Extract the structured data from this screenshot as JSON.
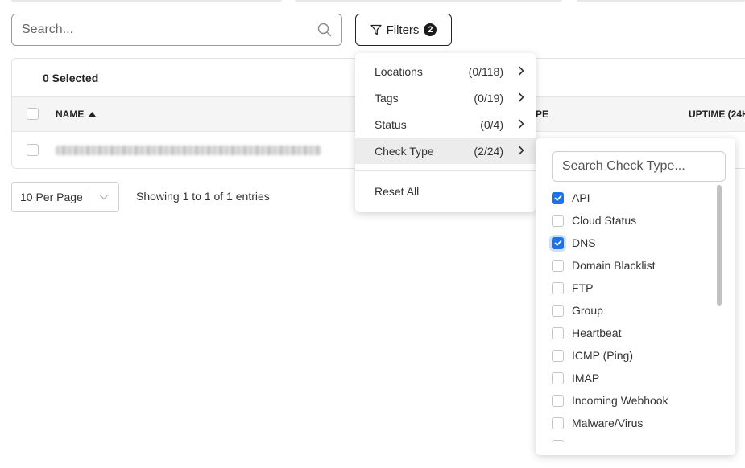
{
  "search": {
    "placeholder": "Search..."
  },
  "filters": {
    "label": "Filters",
    "badge": "2"
  },
  "table": {
    "selected_text": "0 Selected",
    "columns": {
      "name": "NAME",
      "type": "PE",
      "uptime": "UPTIME (24H"
    }
  },
  "pagination": {
    "per_page": "10 Per Page",
    "entries": "Showing 1 to 1 of 1 entries"
  },
  "filter_menu": {
    "items": [
      {
        "label": "Locations",
        "count": "(0/118)"
      },
      {
        "label": "Tags",
        "count": "(0/19)"
      },
      {
        "label": "Status",
        "count": "(0/4)"
      },
      {
        "label": "Check Type",
        "count": "(2/24)"
      }
    ],
    "reset": "Reset All"
  },
  "check_type_menu": {
    "placeholder": "Search Check Type...",
    "options": [
      {
        "label": "API",
        "checked": true
      },
      {
        "label": "Cloud Status",
        "checked": false
      },
      {
        "label": "DNS",
        "checked": true
      },
      {
        "label": "Domain Blacklist",
        "checked": false
      },
      {
        "label": "FTP",
        "checked": false
      },
      {
        "label": "Group",
        "checked": false
      },
      {
        "label": "Heartbeat",
        "checked": false
      },
      {
        "label": "ICMP (Ping)",
        "checked": false
      },
      {
        "label": "IMAP",
        "checked": false
      },
      {
        "label": "Incoming Webhook",
        "checked": false
      },
      {
        "label": "Malware/Virus",
        "checked": false
      }
    ]
  },
  "colors": {
    "accent": "#1a73e8",
    "border_dark": "#222222"
  }
}
